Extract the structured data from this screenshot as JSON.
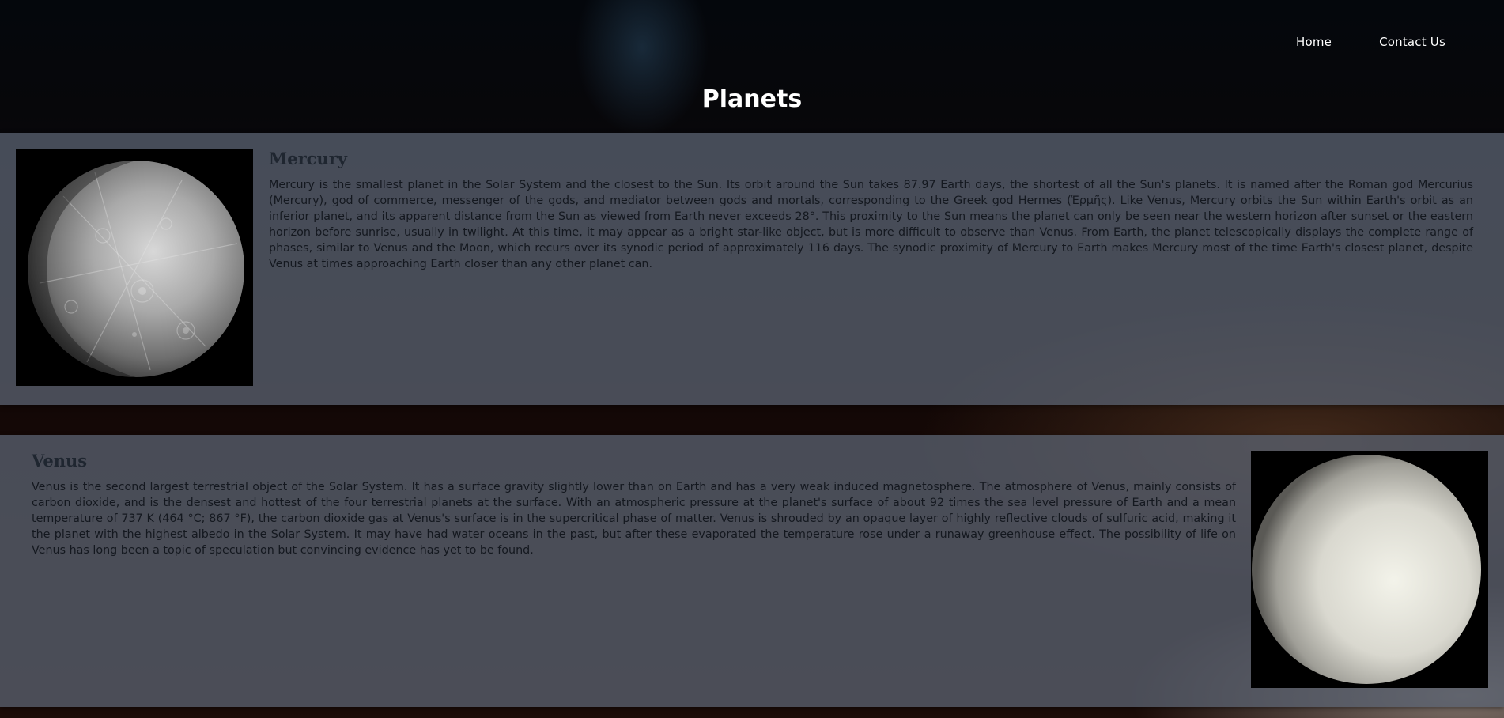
{
  "nav": {
    "home": "Home",
    "contact": "Contact Us"
  },
  "page": {
    "title": "Planets"
  },
  "planets": [
    {
      "name": "Mercury",
      "image_icon": "mercury-planet-image",
      "description": "Mercury is the smallest planet in the Solar System and the closest to the Sun. Its orbit around the Sun takes 87.97 Earth days, the shortest of all the Sun's planets. It is named after the Roman god Mercurius (Mercury), god of commerce, messenger of the gods, and mediator between gods and mortals, corresponding to the Greek god Hermes (Ἑρμῆς). Like Venus, Mercury orbits the Sun within Earth's orbit as an inferior planet, and its apparent distance from the Sun as viewed from Earth never exceeds 28°. This proximity to the Sun means the planet can only be seen near the western horizon after sunset or the eastern horizon before sunrise, usually in twilight. At this time, it may appear as a bright star-like object, but is more difficult to observe than Venus. From Earth, the planet telescopically displays the complete range of phases, similar to Venus and the Moon, which recurs over its synodic period of approximately 116 days. The synodic proximity of Mercury to Earth makes Mercury most of the time Earth's closest planet, despite Venus at times approaching Earth closer than any other planet can."
    },
    {
      "name": "Venus",
      "image_icon": "venus-planet-image",
      "description": "Venus is the second largest terrestrial object of the Solar System. It has a surface gravity slightly lower than on Earth and has a very weak induced magnetosphere. The atmosphere of Venus, mainly consists of carbon dioxide, and is the densest and hottest of the four terrestrial planets at the surface. With an atmospheric pressure at the planet's surface of about 92 times the sea level pressure of Earth and a mean temperature of 737 K (464 °C; 867 °F), the carbon dioxide gas at Venus's surface is in the supercritical phase of matter. Venus is shrouded by an opaque layer of highly reflective clouds of sulfuric acid, making it the planet with the highest albedo in the Solar System. It may have had water oceans in the past, but after these evaporated the temperature rose under a runaway greenhouse effect. The possibility of life on Venus has long been a topic of speculation but convincing evidence has yet to be found."
    }
  ],
  "colors": {
    "card_background": "#58606e",
    "title_text": "#ffffff",
    "body_text": "#14181f"
  }
}
